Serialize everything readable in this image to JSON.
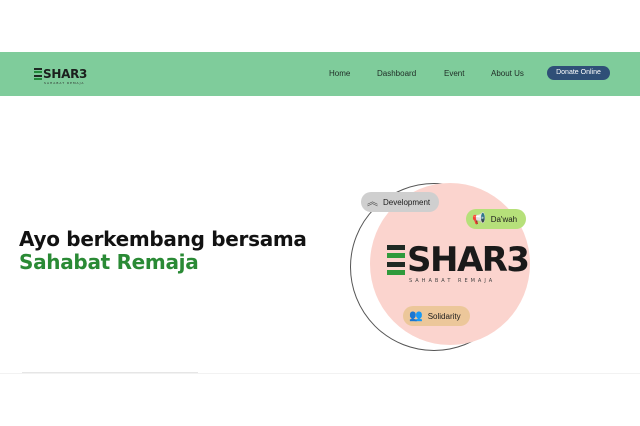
{
  "header": {
    "logo_text": "SHAR3",
    "logo_subtext": "SAHABAT REMAJA",
    "nav": [
      "Home",
      "Dashboard",
      "Event",
      "About Us"
    ],
    "donate_label": "Donate Online"
  },
  "hero": {
    "title_line1": "Ayo berkembang bersama",
    "title_line2": "Sahabat Remaja"
  },
  "illustration": {
    "logo_text": "SHAR3",
    "logo_subtext": "SAHABAT REMAJA",
    "pills": [
      {
        "label": "Development",
        "icon": "double-chevron-up-icon",
        "color": "#cfcfcf"
      },
      {
        "label": "Da'wah",
        "icon": "megaphone-icon",
        "color": "#b6e07a"
      },
      {
        "label": "Solidarity",
        "icon": "people-group-icon",
        "color": "#ecc79a"
      }
    ]
  },
  "colors": {
    "navbar": "#7fcc9b",
    "donate_button": "#2f4f77",
    "accent_green": "#2a8a35",
    "blob_pink": "#fbd4ce"
  }
}
